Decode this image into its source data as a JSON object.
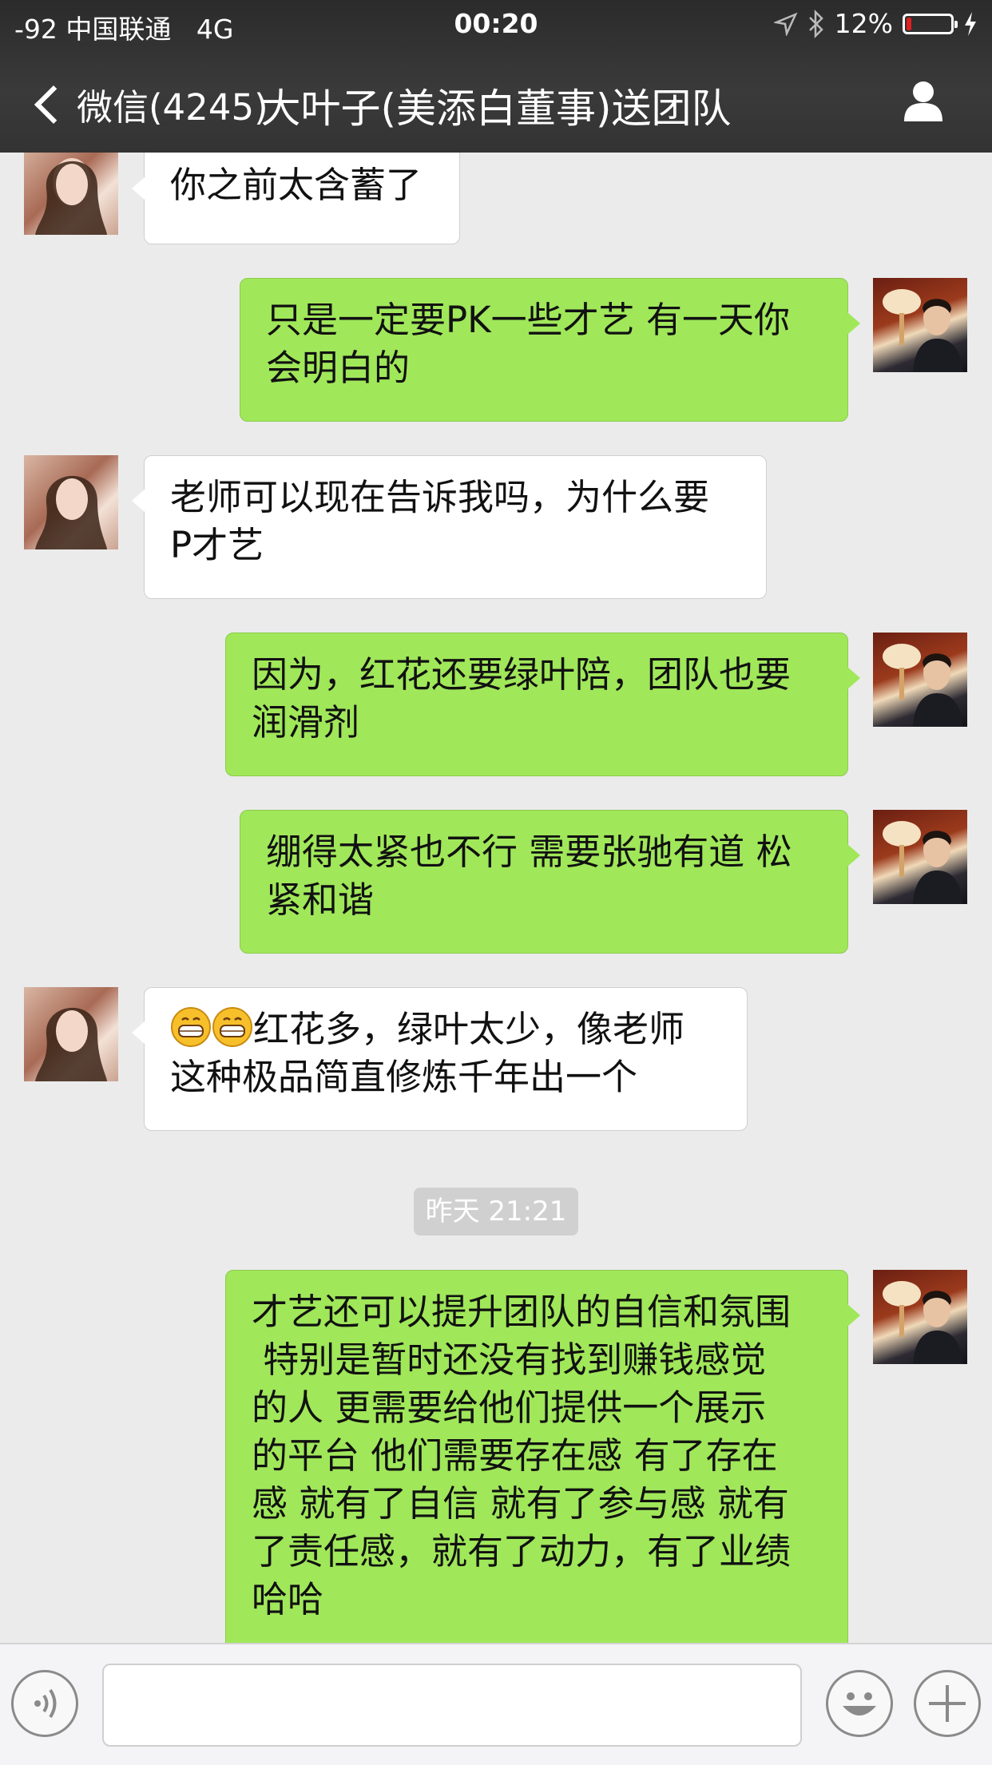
{
  "status_bar": {
    "signal": "-92 中国联通",
    "network": "4G",
    "time": "00:20",
    "battery_text": "12%",
    "battery_level": 0.12,
    "battery_color": "#e02020",
    "icons": [
      "location-icon",
      "bluetooth-icon",
      "battery-icon",
      "charging-icon"
    ]
  },
  "nav": {
    "back_label": "微信(4245)",
    "title": "大叶子(美添白董事)送团队",
    "right_icon": "profile-icon"
  },
  "colors": {
    "sent_bubble": "#a0e75a",
    "received_bubble": "#ffffff",
    "background": "#ebebeb",
    "header": "#333333"
  },
  "messages": [
    {
      "sender": "contact",
      "lines": [
        "你之前太含蓄了"
      ]
    },
    {
      "sender": "me",
      "lines": [
        "只是一定要PK一些才艺 有一天你",
        "会明白的"
      ]
    },
    {
      "sender": "contact",
      "lines": [
        "老师可以现在告诉我吗，为什么要",
        "P才艺"
      ]
    },
    {
      "sender": "me",
      "lines": [
        "因为，红花还要绿叶陪，团队也要",
        "润滑剂"
      ]
    },
    {
      "sender": "me",
      "lines": [
        "绷得太紧也不行 需要张驰有道 松",
        "紧和谐"
      ]
    },
    {
      "sender": "contact",
      "emoji": "grinning-face",
      "emoji_count": 2,
      "lines": [
        "红花多，绿叶太少，像老师",
        "这种极品简直修炼千年出一个"
      ]
    },
    {
      "sender": "me",
      "lines": [
        "才艺还可以提升团队的自信和氛围",
        " 特别是暂时还没有找到赚钱感觉",
        "的人 更需要给他们提供一个展示",
        "的平台 他们需要存在感 有了存在",
        "感 就有了自信 就有了参与感 就有",
        "了责任感，就有了动力，有了业绩",
        "哈哈"
      ]
    }
  ],
  "timestamp": "昨天 21:21",
  "input_bar": {
    "voice_icon": "voice-icon",
    "input_value": "",
    "emoji_icon": "emoji-icon",
    "add_icon": "add-icon"
  }
}
